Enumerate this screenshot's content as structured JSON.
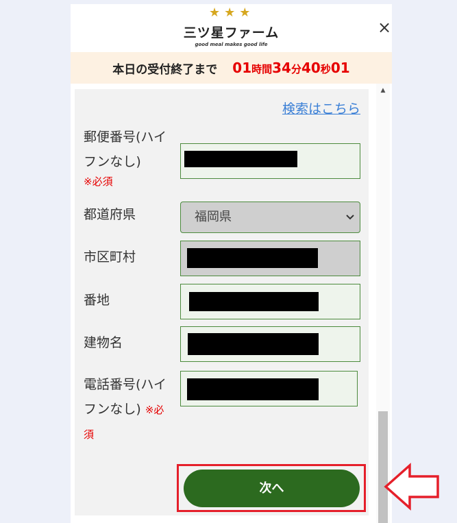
{
  "header": {
    "stars": [
      "★",
      "★",
      "★"
    ],
    "brand": "三ツ星ファーム",
    "tagline": "good meal makes good life",
    "close_icon": "×"
  },
  "countdown": {
    "label": "本日の受付終了まで",
    "hours": "01",
    "hours_unit": "時間",
    "minutes": "34",
    "minutes_unit": "分",
    "seconds": "40",
    "seconds_unit": "秒",
    "fraction": "01"
  },
  "form": {
    "search_link": "検索はこちら",
    "postal": {
      "label_line1": "郵便番号(ハイ",
      "label_line2": "フンなし)",
      "required": "※必須"
    },
    "prefecture": {
      "label": "都道府県",
      "value": "福岡県",
      "chevron": "⌄"
    },
    "city": {
      "label": "市区町村"
    },
    "address": {
      "label": "番地"
    },
    "building": {
      "label": "建物名"
    },
    "phone": {
      "label_line1": "電話番号(ハイ",
      "label_line2": "フンなし)",
      "required_part1": "※必",
      "required_part2": "須"
    },
    "next_button": "次へ"
  },
  "scrollbar": {
    "up_icon": "▲"
  },
  "colors": {
    "brand_green": "#2c6a1f",
    "required_red": "#e60000",
    "link_blue": "#3a7fd6",
    "highlight_red": "#e51f2a",
    "countdown_bg": "#fdf1e2"
  }
}
